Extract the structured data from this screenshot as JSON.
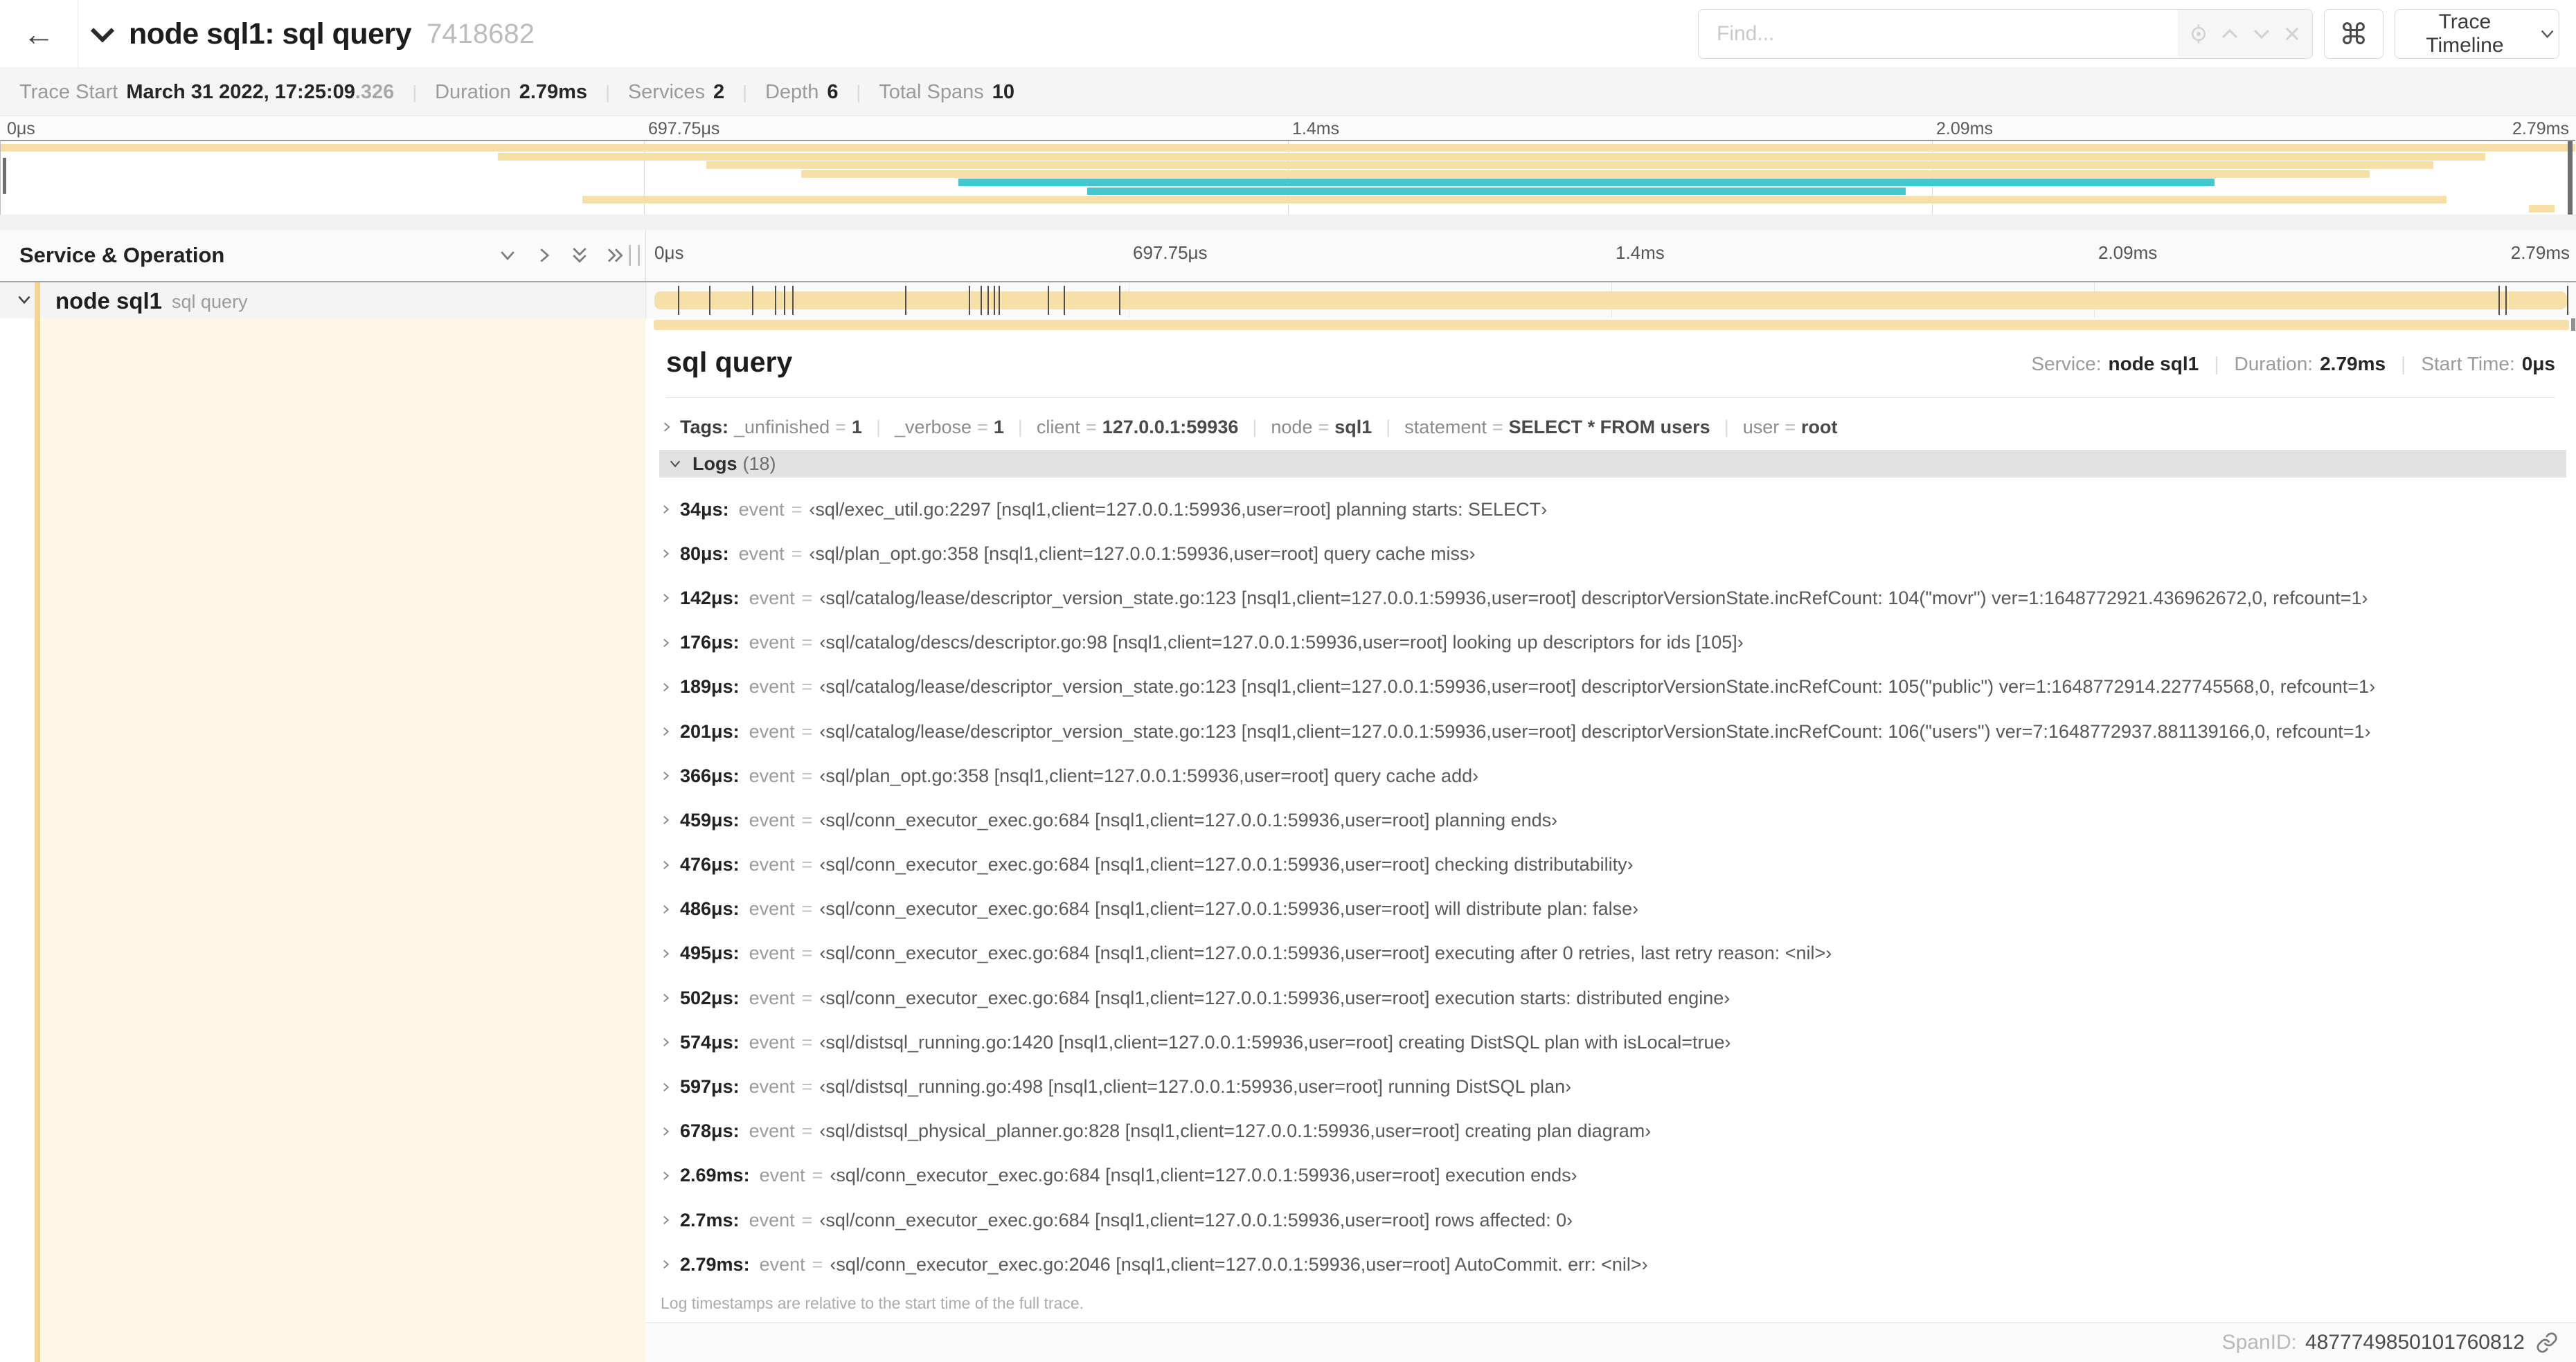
{
  "colors": {
    "span_tan": "#f7dfa8",
    "span_teal": "#46c7cd",
    "stripe": "#f2d591",
    "cream": "#fdf6e4"
  },
  "header": {
    "title": "node sql1: sql query",
    "trace_id": "7418682",
    "find_placeholder": "Find...",
    "shortcut_glyph": "⌘",
    "view_select_label": "Trace Timeline"
  },
  "trace_meta": {
    "trace_start_label": "Trace Start",
    "trace_start_value": "March 31 2022, 17:25:09",
    "trace_start_fraction": ".326",
    "duration_label": "Duration",
    "duration_value": "2.79ms",
    "services_label": "Services",
    "services_value": "2",
    "depth_label": "Depth",
    "depth_value": "6",
    "total_spans_label": "Total Spans",
    "total_spans_value": "10"
  },
  "minimap": {
    "ticks": [
      "0μs",
      "697.75μs",
      "1.4ms",
      "2.09ms",
      "2.79ms"
    ],
    "bars": [
      {
        "row": 0,
        "start": 0,
        "end": 100,
        "color": "tan"
      },
      {
        "row": 1,
        "start": 19.3,
        "end": 96.5,
        "color": "tan"
      },
      {
        "row": 2,
        "start": 27.4,
        "end": 94.5,
        "color": "tan"
      },
      {
        "row": 3,
        "start": 31.1,
        "end": 92.0,
        "color": "tan"
      },
      {
        "row": 4,
        "start": 37.2,
        "end": 86.0,
        "color": "teal"
      },
      {
        "row": 5,
        "start": 42.2,
        "end": 74.0,
        "color": "teal"
      },
      {
        "row": 6,
        "start": 22.6,
        "end": 95.0,
        "color": "tan"
      },
      {
        "row": 7,
        "start": 98.2,
        "end": 99.2,
        "color": "tan"
      }
    ]
  },
  "timeline": {
    "header_label": "Service & Operation",
    "ruler_ticks": [
      "0μs",
      "697.75μs",
      "1.4ms",
      "2.09ms",
      "2.79ms"
    ],
    "row": {
      "service": "node sql1",
      "operation": "sql query"
    },
    "total_us": 2790,
    "log_marker_times_us": [
      34,
      80,
      142,
      176,
      189,
      201,
      366,
      459,
      476,
      486,
      495,
      502,
      574,
      597,
      678,
      2690,
      2700,
      2790
    ]
  },
  "detail": {
    "operation": "sql query",
    "service_label": "Service:",
    "service_value": "node sql1",
    "duration_label": "Duration:",
    "duration_value": "2.79ms",
    "start_label": "Start Time:",
    "start_value": "0μs",
    "tags_label": "Tags:",
    "tags": [
      {
        "key": "_unfinished",
        "value": "1"
      },
      {
        "key": "_verbose",
        "value": "1"
      },
      {
        "key": "client",
        "value": "127.0.0.1:59936"
      },
      {
        "key": "node",
        "value": "sql1"
      },
      {
        "key": "statement",
        "value": "SELECT * FROM users"
      },
      {
        "key": "user",
        "value": "root"
      }
    ],
    "logs_label": "Logs",
    "logs_count": "(18)",
    "logs": [
      {
        "time": "34μs:",
        "field": "event",
        "value": "‹sql/exec_util.go:2297 [nsql1,client=127.0.0.1:59936,user=root] planning starts: SELECT›"
      },
      {
        "time": "80μs:",
        "field": "event",
        "value": "‹sql/plan_opt.go:358 [nsql1,client=127.0.0.1:59936,user=root] query cache miss›"
      },
      {
        "time": "142μs:",
        "field": "event",
        "value": "‹sql/catalog/lease/descriptor_version_state.go:123 [nsql1,client=127.0.0.1:59936,user=root] descriptorVersionState.incRefCount: 104(\"movr\") ver=1:1648772921.436962672,0, refcount=1›"
      },
      {
        "time": "176μs:",
        "field": "event",
        "value": "‹sql/catalog/descs/descriptor.go:98 [nsql1,client=127.0.0.1:59936,user=root] looking up descriptors for ids [105]›"
      },
      {
        "time": "189μs:",
        "field": "event",
        "value": "‹sql/catalog/lease/descriptor_version_state.go:123 [nsql1,client=127.0.0.1:59936,user=root] descriptorVersionState.incRefCount: 105(\"public\") ver=1:1648772914.227745568,0, refcount=1›"
      },
      {
        "time": "201μs:",
        "field": "event",
        "value": "‹sql/catalog/lease/descriptor_version_state.go:123 [nsql1,client=127.0.0.1:59936,user=root] descriptorVersionState.incRefCount: 106(\"users\") ver=7:1648772937.881139166,0, refcount=1›"
      },
      {
        "time": "366μs:",
        "field": "event",
        "value": "‹sql/plan_opt.go:358 [nsql1,client=127.0.0.1:59936,user=root] query cache add›"
      },
      {
        "time": "459μs:",
        "field": "event",
        "value": "‹sql/conn_executor_exec.go:684 [nsql1,client=127.0.0.1:59936,user=root] planning ends›"
      },
      {
        "time": "476μs:",
        "field": "event",
        "value": "‹sql/conn_executor_exec.go:684 [nsql1,client=127.0.0.1:59936,user=root] checking distributability›"
      },
      {
        "time": "486μs:",
        "field": "event",
        "value": "‹sql/conn_executor_exec.go:684 [nsql1,client=127.0.0.1:59936,user=root] will distribute plan: false›"
      },
      {
        "time": "495μs:",
        "field": "event",
        "value": "‹sql/conn_executor_exec.go:684 [nsql1,client=127.0.0.1:59936,user=root] executing after 0 retries, last retry reason: <nil>›"
      },
      {
        "time": "502μs:",
        "field": "event",
        "value": "‹sql/conn_executor_exec.go:684 [nsql1,client=127.0.0.1:59936,user=root] execution starts: distributed engine›"
      },
      {
        "time": "574μs:",
        "field": "event",
        "value": "‹sql/distsql_running.go:1420 [nsql1,client=127.0.0.1:59936,user=root] creating DistSQL plan with isLocal=true›"
      },
      {
        "time": "597μs:",
        "field": "event",
        "value": "‹sql/distsql_running.go:498 [nsql1,client=127.0.0.1:59936,user=root] running DistSQL plan›"
      },
      {
        "time": "678μs:",
        "field": "event",
        "value": "‹sql/distsql_physical_planner.go:828 [nsql1,client=127.0.0.1:59936,user=root] creating plan diagram›"
      },
      {
        "time": "2.69ms:",
        "field": "event",
        "value": "‹sql/conn_executor_exec.go:684 [nsql1,client=127.0.0.1:59936,user=root] execution ends›"
      },
      {
        "time": "2.7ms:",
        "field": "event",
        "value": "‹sql/conn_executor_exec.go:684 [nsql1,client=127.0.0.1:59936,user=root] rows affected: 0›"
      },
      {
        "time": "2.79ms:",
        "field": "event",
        "value": "‹sql/conn_executor_exec.go:2046 [nsql1,client=127.0.0.1:59936,user=root] AutoCommit. err: <nil>›"
      }
    ],
    "footnote": "Log timestamps are relative to the start time of the full trace.",
    "spanid_label": "SpanID:",
    "spanid_value": "4877749850101760812"
  }
}
